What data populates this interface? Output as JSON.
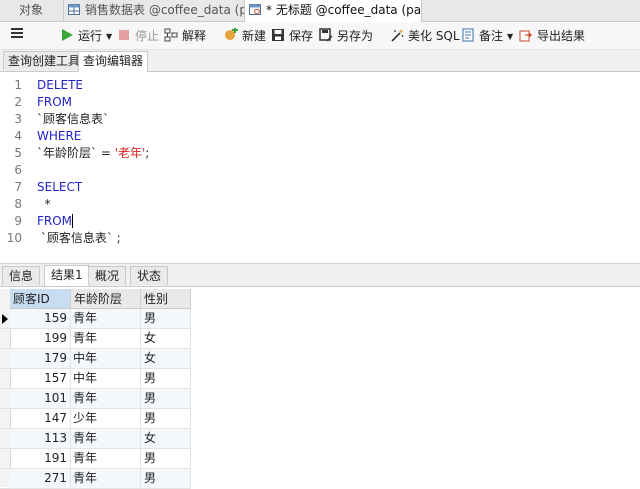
{
  "tabs": [
    {
      "label": "对象"
    },
    {
      "label": "销售数据表 @coffee_data (p..."
    },
    {
      "label": "* 无标题 @coffee_data (pac..."
    }
  ],
  "toolbar": {
    "run": "运行",
    "stop": "停止",
    "explain": "解释",
    "new": "新建",
    "save": "保存",
    "save_as": "另存为",
    "beautify": "美化 SQL",
    "memo": "备注",
    "export": "导出结果"
  },
  "subtabs": [
    "查询创建工具",
    "查询编辑器"
  ],
  "editor": {
    "line_numbers": [
      "1",
      "2",
      "3",
      "4",
      "5",
      "6",
      "7",
      "8",
      "9",
      "10"
    ],
    "l1": "DELETE",
    "l2": "FROM",
    "l3": " `顾客信息表`",
    "l4": "WHERE",
    "l5_col": " `年龄阶层` = ",
    "l5_val": "'老年'",
    "l5_end": ";",
    "l7": "SELECT",
    "l8": "  *",
    "l9": "FROM",
    "l10": " `顾客信息表` ;"
  },
  "result_tabs": [
    "信息",
    "结果1",
    "概况",
    "状态"
  ],
  "grid": {
    "columns": [
      "顾客ID",
      "年龄阶层",
      "性别"
    ],
    "rows": [
      [
        "159",
        "青年",
        "男"
      ],
      [
        "199",
        "青年",
        "女"
      ],
      [
        "179",
        "中年",
        "女"
      ],
      [
        "157",
        "中年",
        "男"
      ],
      [
        "101",
        "青年",
        "男"
      ],
      [
        "147",
        "少年",
        "男"
      ],
      [
        "113",
        "青年",
        "女"
      ],
      [
        "191",
        "青年",
        "男"
      ],
      [
        "271",
        "青年",
        "男"
      ]
    ]
  },
  "colors": {
    "keyword": "#2323c9",
    "string": "#dd2222",
    "accent": "#c8ddf2"
  }
}
